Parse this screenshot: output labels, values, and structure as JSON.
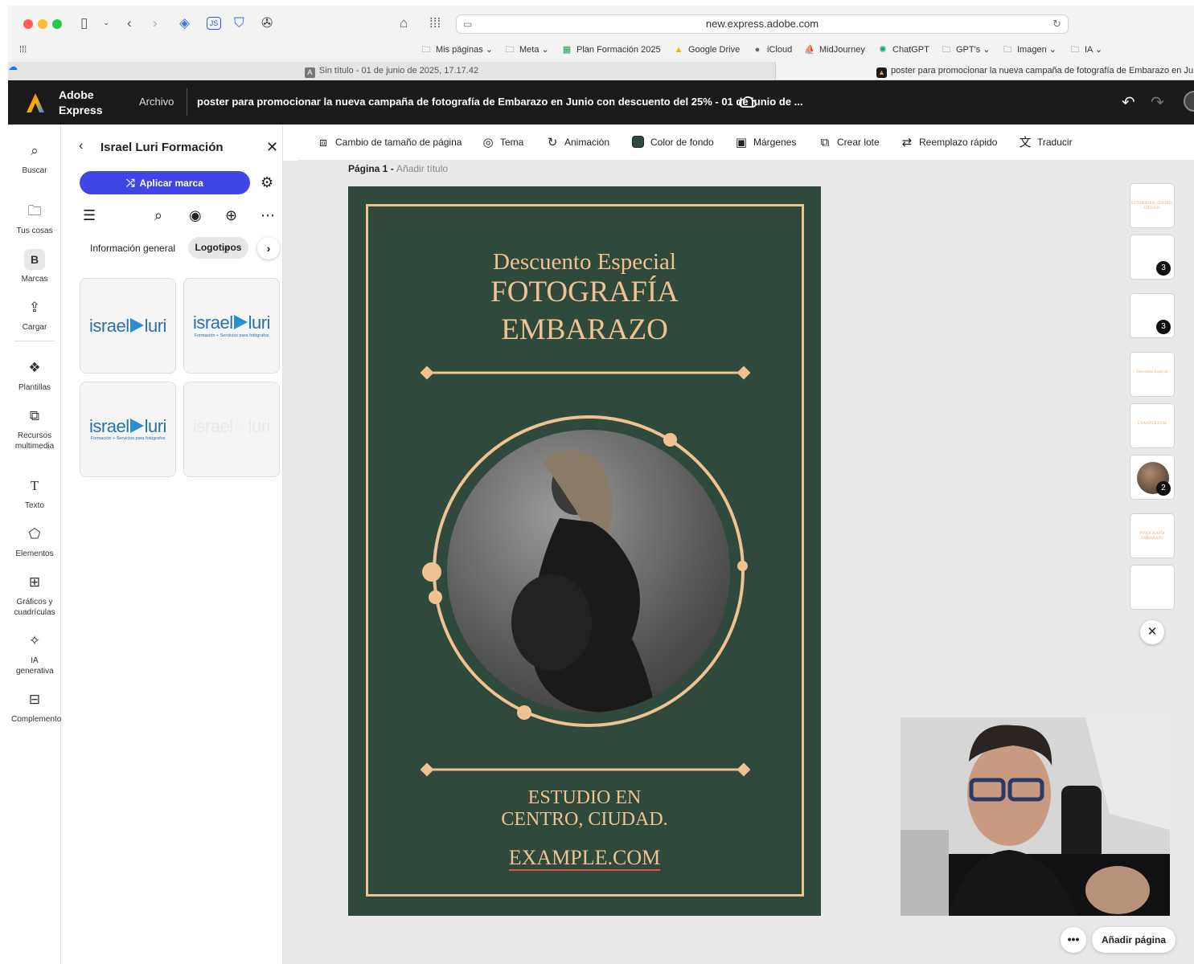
{
  "browser": {
    "url": "new.express.adobe.com",
    "bookmarks": [
      {
        "label": "Mis páginas",
        "icon": "folder-icon"
      },
      {
        "label": "Meta",
        "icon": "folder-icon"
      },
      {
        "label": "Plan Formación 2025",
        "icon": "sheets-icon"
      },
      {
        "label": "Google Drive",
        "icon": "drive-icon"
      },
      {
        "label": "iCloud",
        "icon": "apple-icon"
      },
      {
        "label": "MidJourney",
        "icon": "sail-icon"
      },
      {
        "label": "ChatGPT",
        "icon": "openai-icon"
      },
      {
        "label": "GPT's",
        "icon": "folder-icon"
      },
      {
        "label": "Imagen",
        "icon": "folder-icon"
      },
      {
        "label": "IA",
        "icon": "folder-icon"
      }
    ],
    "tab_active": "Sin título - 01 de junio de 2025, 17.17.42",
    "tab_other": "poster para promocionar la nueva campaña de fotografía de Embarazo en Jun"
  },
  "app": {
    "brand_line1": "Adobe",
    "brand_line2": "Express",
    "menu_file": "Archivo",
    "doc_title": "poster para promocionar la nueva campaña de fotografía de Embarazo en Junio con descuento del 25% - 01 de junio de ..."
  },
  "rail": [
    {
      "label": "Buscar",
      "icon": "search-icon"
    },
    {
      "label": "Tus cosas",
      "icon": "folder-icon"
    },
    {
      "label": "Marcas",
      "icon": "brand-icon"
    },
    {
      "label": "Cargar",
      "icon": "upload-icon"
    },
    {
      "label": "Plantillas",
      "icon": "templates-icon"
    },
    {
      "label": "Recursos multimedia",
      "icon": "media-icon"
    },
    {
      "label": "Texto",
      "icon": "text-icon"
    },
    {
      "label": "Elementos",
      "icon": "shapes-icon"
    },
    {
      "label": "Gráficos y cuadrículas",
      "icon": "grid-icon"
    },
    {
      "label": "IA generativa",
      "icon": "sparkle-icon"
    },
    {
      "label": "Complementos",
      "icon": "addons-icon"
    }
  ],
  "panel": {
    "title": "Israel Luri Formación",
    "apply_label": "Aplicar marca",
    "tab_general": "Información general",
    "tab_logos": "Logotipos",
    "logos": [
      {
        "word_a": "israel",
        "word_b": "luri",
        "sub": ""
      },
      {
        "word_a": "israel",
        "word_b": "luri",
        "sub": "Formación + Servicios para fotógrafos"
      },
      {
        "word_a": "israel",
        "word_b": "luri",
        "sub": "Formación + Servicios para fotógrafos"
      },
      {
        "word_a": "israel",
        "word_b": "luri",
        "sub": ""
      }
    ]
  },
  "context_bar": [
    {
      "label": "Cambio de tamaño de página",
      "icon": "resize-icon"
    },
    {
      "label": "Tema",
      "icon": "palette-icon"
    },
    {
      "label": "Animación",
      "icon": "animation-icon"
    },
    {
      "label": "Color de fondo",
      "icon": "color-swatch-icon"
    },
    {
      "label": "Márgenes",
      "icon": "margins-icon"
    },
    {
      "label": "Crear lote",
      "icon": "batch-icon"
    },
    {
      "label": "Reemplazo rápido",
      "icon": "swap-icon"
    },
    {
      "label": "Traducir",
      "icon": "translate-icon"
    }
  ],
  "canvas": {
    "page_label": "Página 1 -",
    "page_title_placeholder": "Añadir título"
  },
  "poster": {
    "subtitle": "Descuento Especial",
    "title_line1": "FOTOGRAFÍA",
    "title_line2": "EMBARAZO",
    "address_line1": "ESTUDIO EN",
    "address_line2": "CENTRO, CIUDAD.",
    "url": "EXAMPLE.COM",
    "bg_color": "#2f4a3c",
    "accent_color": "#f0c292"
  },
  "thumbnails": [
    {
      "text": "ESTUDIO EN CENTRO, CIUDAD.",
      "badge": ""
    },
    {
      "text": "",
      "badge": "3"
    },
    {
      "text": "",
      "badge": "3"
    },
    {
      "text": "Descuento Especial",
      "badge": ""
    },
    {
      "text": "EXAMPLE.COM",
      "badge": ""
    },
    {
      "text": "",
      "badge": "2"
    },
    {
      "text": "FOTOGRAFÍA EMBARAZO",
      "badge": ""
    },
    {
      "text": "",
      "badge": ""
    }
  ],
  "bottom": {
    "more_label": "•••",
    "add_page": "Añadir página"
  }
}
